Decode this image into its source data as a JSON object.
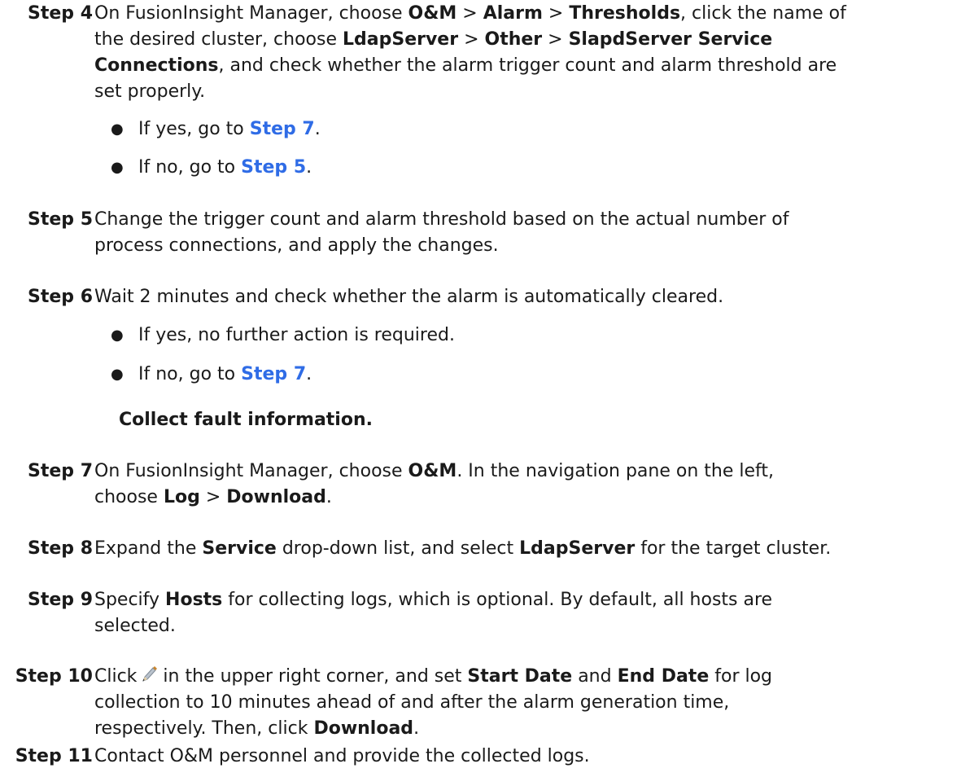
{
  "step4": {
    "label": "Step 4",
    "l1_a": "On FusionInsight Manager, choose ",
    "l1_b": "O&M",
    "l1_c": " > ",
    "l1_d": "Alarm",
    "l1_e": " > ",
    "l1_f": "Thresholds",
    "l1_g": ", click the name of",
    "l2_a": "the desired cluster, choose ",
    "l2_b": "LdapServer",
    "l2_c": " > ",
    "l2_d": "Other",
    "l2_e": " > ",
    "l2_f": "SlapdServer Service",
    "l3_a": "Connections",
    "l3_b": ", and check whether the alarm trigger count and alarm threshold are",
    "l4": "set properly.",
    "bullets": [
      {
        "pre": "If yes, go to ",
        "link": "Step 7",
        "post": "."
      },
      {
        "pre": "If no, go to ",
        "link": "Step 5",
        "post": "."
      }
    ]
  },
  "step5": {
    "label": "Step 5",
    "l1": "Change the trigger count and alarm threshold based on the actual number of",
    "l2": "process connections, and apply the changes."
  },
  "step6": {
    "label": "Step 6",
    "l1": "Wait 2 minutes and check whether the alarm is automatically cleared.",
    "bullet1": "If yes, no further action is required.",
    "bullet2": {
      "pre": "If no, go to ",
      "link": "Step 7",
      "post": "."
    }
  },
  "section_heading": "Collect fault information.",
  "step7": {
    "label": "Step 7",
    "l1_a": "On FusionInsight Manager, choose ",
    "l1_b": "O&M",
    "l1_c": ". In the navigation pane on the left,",
    "l2_a": "choose ",
    "l2_b": "Log",
    "l2_c": " > ",
    "l2_d": "Download",
    "l2_e": "."
  },
  "step8": {
    "label": "Step 8",
    "l1_a": "Expand the ",
    "l1_b": "Service",
    "l1_c": " drop-down list, and select ",
    "l1_d": "LdapServer",
    "l1_e": " for the target cluster."
  },
  "step9": {
    "label": "Step 9",
    "l1_a": "Specify ",
    "l1_b": "Hosts",
    "l1_c": " for collecting logs, which is optional. By default, all hosts are",
    "l2": "selected."
  },
  "step10": {
    "label": "Step 10",
    "l1_a": "Click",
    "l1_b": "in the upper right corner, and set ",
    "l1_c": "Start Date",
    "l1_d": " and ",
    "l1_e": "End Date",
    "l1_f": " for log",
    "l2": "collection to 10 minutes ahead of and after the alarm generation time,",
    "l3_a": "respectively. Then, click ",
    "l3_b": "Download",
    "l3_c": ".",
    "icon": "edit-pencil-icon"
  },
  "step11": {
    "label": "Step 11",
    "l1": "Contact O&M personnel and provide the collected logs."
  },
  "bullet_glyph": "●",
  "colors": {
    "text": "#1a1a1a",
    "link": "#2f6ce6"
  }
}
